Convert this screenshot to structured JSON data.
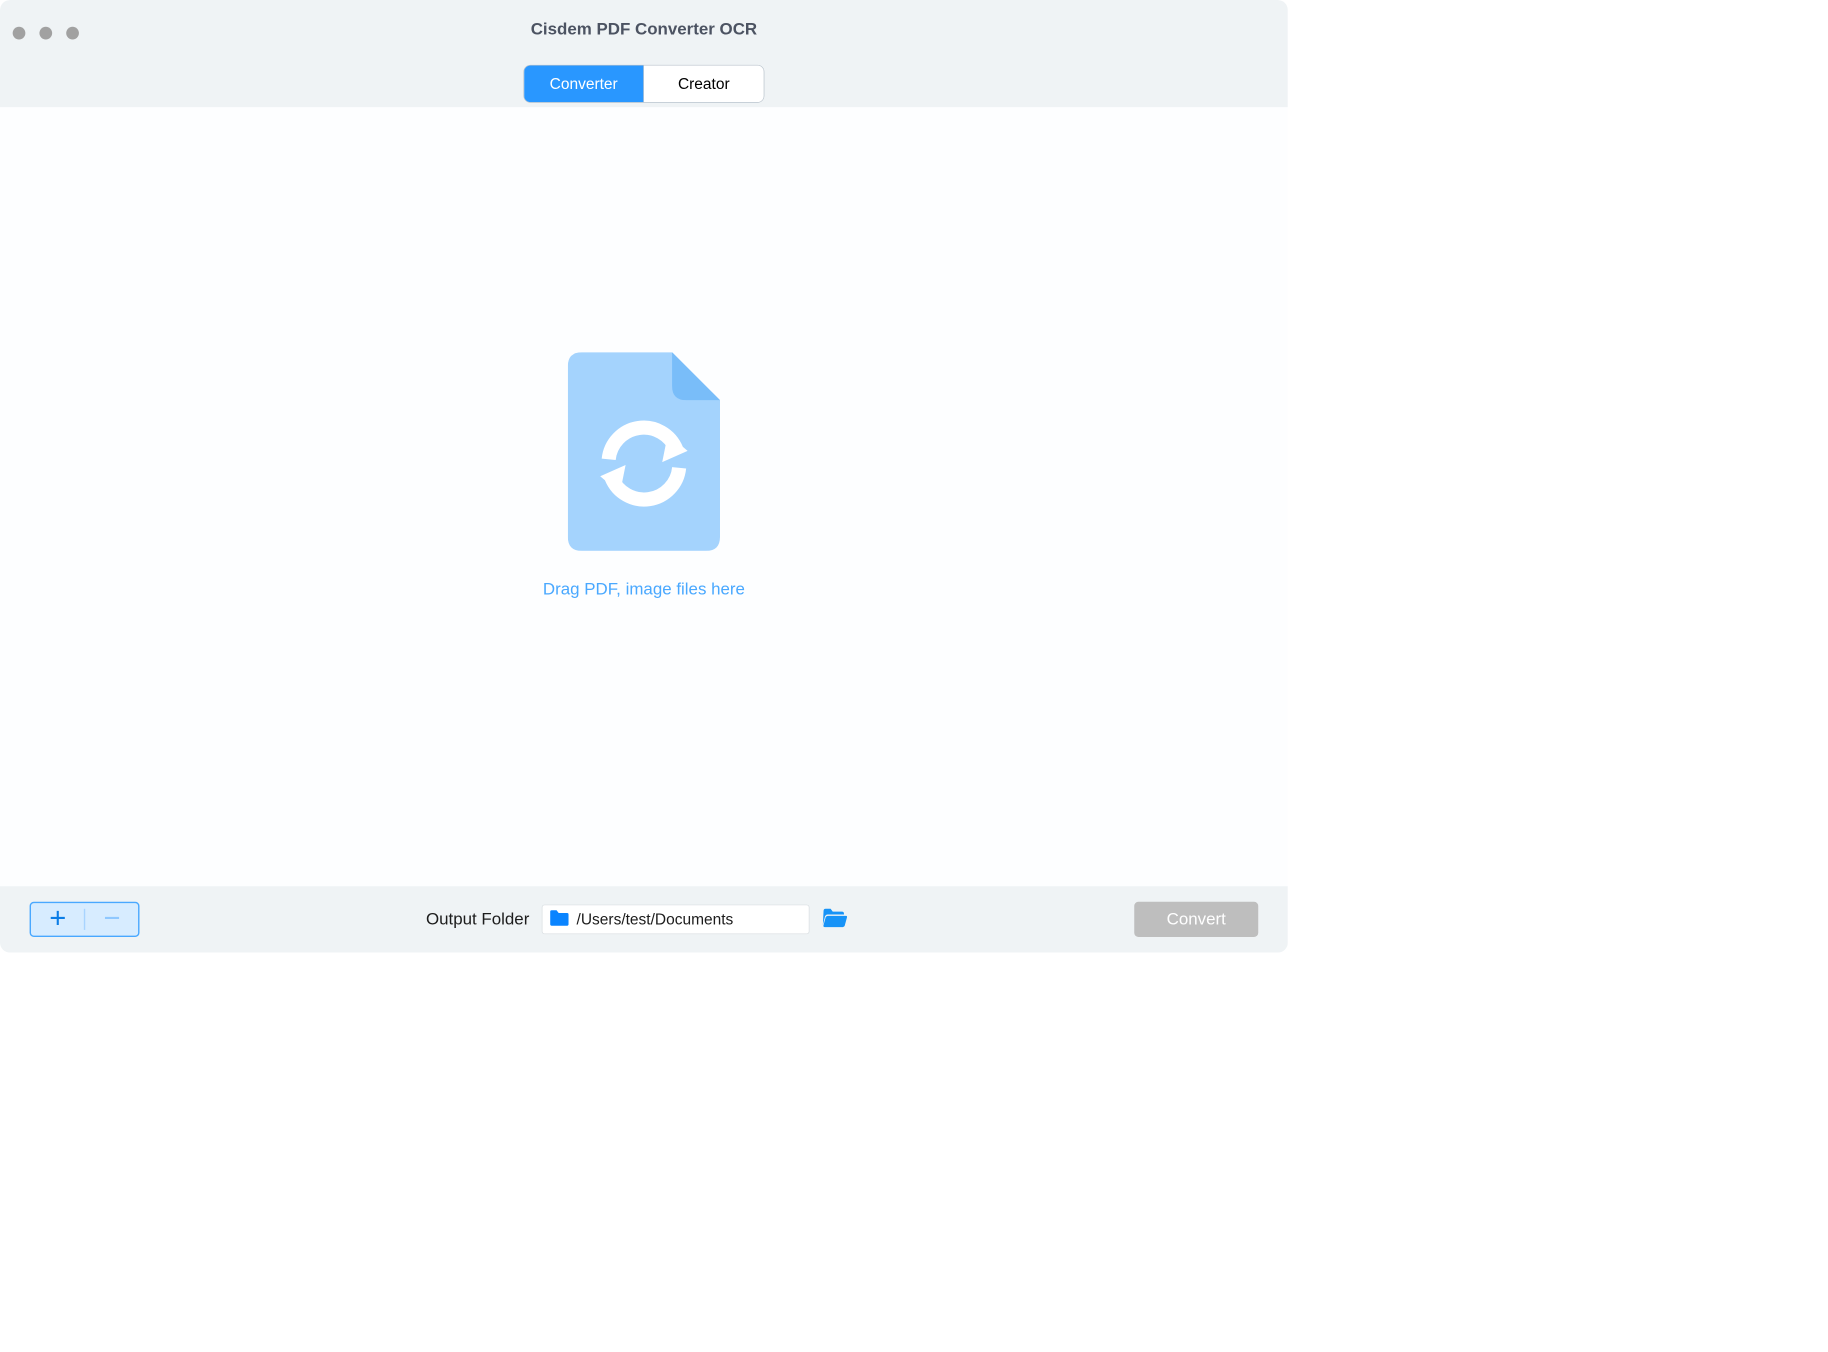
{
  "window": {
    "title": "Cisdem PDF Converter OCR"
  },
  "tabs": {
    "converter": "Converter",
    "creator": "Creator"
  },
  "dropzone": {
    "hint": "Drag PDF, image files here"
  },
  "footer": {
    "output_label": "Output Folder",
    "output_path": "/Users/test/Documents",
    "convert_label": "Convert"
  }
}
